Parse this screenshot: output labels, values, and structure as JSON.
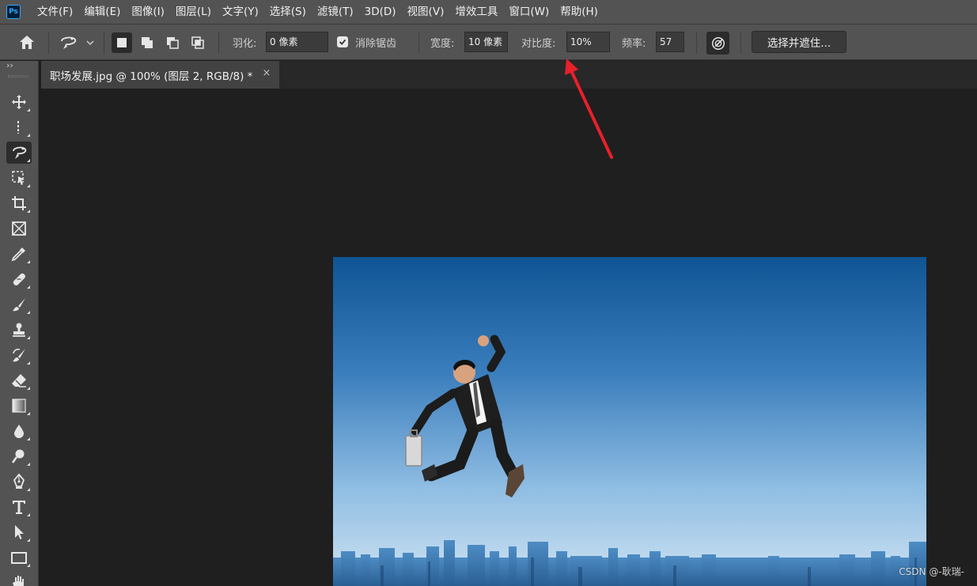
{
  "app": {
    "logo_text": "Ps"
  },
  "menu": [
    "文件(F)",
    "编辑(E)",
    "图像(I)",
    "图层(L)",
    "文字(Y)",
    "选择(S)",
    "滤镜(T)",
    "3D(D)",
    "视图(V)",
    "增效工具",
    "窗口(W)",
    "帮助(H)"
  ],
  "options_bar": {
    "feather_label": "羽化:",
    "feather_value": "0 像素",
    "antialias_label": "消除锯齿",
    "antialias_checked": true,
    "width_label": "宽度:",
    "width_value": "10 像素",
    "contrast_label": "对比度:",
    "contrast_value": "10%",
    "frequency_label": "频率:",
    "frequency_value": "57",
    "select_mask_button": "选择并遮住..."
  },
  "document_tab": {
    "title": "职场发展.jpg @ 100% (图层 2, RGB/8) *",
    "close": "×"
  },
  "toolbar": {
    "collapse": "››",
    "tools": [
      {
        "name": "move-tool",
        "icon": "move-icon"
      },
      {
        "name": "marquee-tool",
        "icon": "marquee-icon"
      },
      {
        "name": "magnetic-lasso-tool",
        "icon": "magnetic-lasso-icon",
        "selected": true
      },
      {
        "name": "object-selection-tool",
        "icon": "object-selection-icon"
      },
      {
        "name": "crop-tool",
        "icon": "crop-icon"
      },
      {
        "name": "frame-tool",
        "icon": "frame-icon"
      },
      {
        "name": "eyedropper-tool",
        "icon": "eyedropper-icon"
      },
      {
        "name": "healing-brush-tool",
        "icon": "bandage-icon"
      },
      {
        "name": "brush-tool",
        "icon": "brush-icon"
      },
      {
        "name": "clone-stamp-tool",
        "icon": "stamp-icon"
      },
      {
        "name": "history-brush-tool",
        "icon": "history-brush-icon"
      },
      {
        "name": "eraser-tool",
        "icon": "eraser-icon"
      },
      {
        "name": "gradient-tool",
        "icon": "gradient-icon"
      },
      {
        "name": "blur-tool",
        "icon": "drop-icon"
      },
      {
        "name": "dodge-tool",
        "icon": "dodge-icon"
      },
      {
        "name": "pen-tool",
        "icon": "pen-icon"
      },
      {
        "name": "type-tool",
        "icon": "type-icon"
      },
      {
        "name": "path-selection-tool",
        "icon": "arrow-icon"
      },
      {
        "name": "rectangle-tool",
        "icon": "rectangle-icon"
      },
      {
        "name": "hand-tool",
        "icon": "hand-icon"
      }
    ]
  },
  "colors": {
    "chrome": "#535353",
    "workspace": "#1f1f1f",
    "annotation_arrow": "#e8202a",
    "ps_blue": "#31a8ff"
  },
  "watermark": "CSDN @-耿瑞-"
}
